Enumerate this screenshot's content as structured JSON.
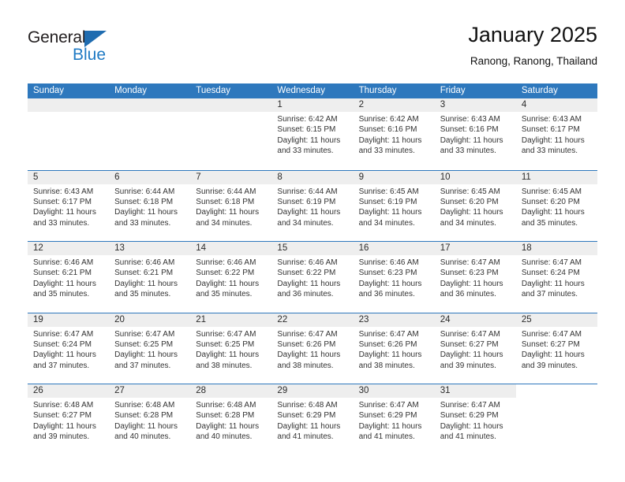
{
  "brand": {
    "name_top": "General",
    "name_bottom": "Blue",
    "triangle_icon": "triangle-icon",
    "accent_color": "#1f7ac4"
  },
  "header": {
    "title": "January 2025",
    "subtitle": "Ranong, Ranong, Thailand"
  },
  "colors": {
    "header_band": "#2e78bd",
    "daynum_band": "#eeeeee",
    "text": "#333333"
  },
  "weekdays": [
    "Sunday",
    "Monday",
    "Tuesday",
    "Wednesday",
    "Thursday",
    "Friday",
    "Saturday"
  ],
  "weeks": [
    {
      "band_cols": 7,
      "days": [
        {
          "num": "",
          "empty": true,
          "l1": "",
          "l2": "",
          "l3": "",
          "l4": ""
        },
        {
          "num": "",
          "empty": true,
          "l1": "",
          "l2": "",
          "l3": "",
          "l4": ""
        },
        {
          "num": "",
          "empty": true,
          "l1": "",
          "l2": "",
          "l3": "",
          "l4": ""
        },
        {
          "num": "1",
          "l1": "Sunrise: 6:42 AM",
          "l2": "Sunset: 6:15 PM",
          "l3": "Daylight: 11 hours",
          "l4": "and 33 minutes."
        },
        {
          "num": "2",
          "l1": "Sunrise: 6:42 AM",
          "l2": "Sunset: 6:16 PM",
          "l3": "Daylight: 11 hours",
          "l4": "and 33 minutes."
        },
        {
          "num": "3",
          "l1": "Sunrise: 6:43 AM",
          "l2": "Sunset: 6:16 PM",
          "l3": "Daylight: 11 hours",
          "l4": "and 33 minutes."
        },
        {
          "num": "4",
          "l1": "Sunrise: 6:43 AM",
          "l2": "Sunset: 6:17 PM",
          "l3": "Daylight: 11 hours",
          "l4": "and 33 minutes."
        }
      ]
    },
    {
      "band_cols": 7,
      "days": [
        {
          "num": "5",
          "l1": "Sunrise: 6:43 AM",
          "l2": "Sunset: 6:17 PM",
          "l3": "Daylight: 11 hours",
          "l4": "and 33 minutes."
        },
        {
          "num": "6",
          "l1": "Sunrise: 6:44 AM",
          "l2": "Sunset: 6:18 PM",
          "l3": "Daylight: 11 hours",
          "l4": "and 33 minutes."
        },
        {
          "num": "7",
          "l1": "Sunrise: 6:44 AM",
          "l2": "Sunset: 6:18 PM",
          "l3": "Daylight: 11 hours",
          "l4": "and 34 minutes."
        },
        {
          "num": "8",
          "l1": "Sunrise: 6:44 AM",
          "l2": "Sunset: 6:19 PM",
          "l3": "Daylight: 11 hours",
          "l4": "and 34 minutes."
        },
        {
          "num": "9",
          "l1": "Sunrise: 6:45 AM",
          "l2": "Sunset: 6:19 PM",
          "l3": "Daylight: 11 hours",
          "l4": "and 34 minutes."
        },
        {
          "num": "10",
          "l1": "Sunrise: 6:45 AM",
          "l2": "Sunset: 6:20 PM",
          "l3": "Daylight: 11 hours",
          "l4": "and 34 minutes."
        },
        {
          "num": "11",
          "l1": "Sunrise: 6:45 AM",
          "l2": "Sunset: 6:20 PM",
          "l3": "Daylight: 11 hours",
          "l4": "and 35 minutes."
        }
      ]
    },
    {
      "band_cols": 7,
      "days": [
        {
          "num": "12",
          "l1": "Sunrise: 6:46 AM",
          "l2": "Sunset: 6:21 PM",
          "l3": "Daylight: 11 hours",
          "l4": "and 35 minutes."
        },
        {
          "num": "13",
          "l1": "Sunrise: 6:46 AM",
          "l2": "Sunset: 6:21 PM",
          "l3": "Daylight: 11 hours",
          "l4": "and 35 minutes."
        },
        {
          "num": "14",
          "l1": "Sunrise: 6:46 AM",
          "l2": "Sunset: 6:22 PM",
          "l3": "Daylight: 11 hours",
          "l4": "and 35 minutes."
        },
        {
          "num": "15",
          "l1": "Sunrise: 6:46 AM",
          "l2": "Sunset: 6:22 PM",
          "l3": "Daylight: 11 hours",
          "l4": "and 36 minutes."
        },
        {
          "num": "16",
          "l1": "Sunrise: 6:46 AM",
          "l2": "Sunset: 6:23 PM",
          "l3": "Daylight: 11 hours",
          "l4": "and 36 minutes."
        },
        {
          "num": "17",
          "l1": "Sunrise: 6:47 AM",
          "l2": "Sunset: 6:23 PM",
          "l3": "Daylight: 11 hours",
          "l4": "and 36 minutes."
        },
        {
          "num": "18",
          "l1": "Sunrise: 6:47 AM",
          "l2": "Sunset: 6:24 PM",
          "l3": "Daylight: 11 hours",
          "l4": "and 37 minutes."
        }
      ]
    },
    {
      "band_cols": 7,
      "days": [
        {
          "num": "19",
          "l1": "Sunrise: 6:47 AM",
          "l2": "Sunset: 6:24 PM",
          "l3": "Daylight: 11 hours",
          "l4": "and 37 minutes."
        },
        {
          "num": "20",
          "l1": "Sunrise: 6:47 AM",
          "l2": "Sunset: 6:25 PM",
          "l3": "Daylight: 11 hours",
          "l4": "and 37 minutes."
        },
        {
          "num": "21",
          "l1": "Sunrise: 6:47 AM",
          "l2": "Sunset: 6:25 PM",
          "l3": "Daylight: 11 hours",
          "l4": "and 38 minutes."
        },
        {
          "num": "22",
          "l1": "Sunrise: 6:47 AM",
          "l2": "Sunset: 6:26 PM",
          "l3": "Daylight: 11 hours",
          "l4": "and 38 minutes."
        },
        {
          "num": "23",
          "l1": "Sunrise: 6:47 AM",
          "l2": "Sunset: 6:26 PM",
          "l3": "Daylight: 11 hours",
          "l4": "and 38 minutes."
        },
        {
          "num": "24",
          "l1": "Sunrise: 6:47 AM",
          "l2": "Sunset: 6:27 PM",
          "l3": "Daylight: 11 hours",
          "l4": "and 39 minutes."
        },
        {
          "num": "25",
          "l1": "Sunrise: 6:47 AM",
          "l2": "Sunset: 6:27 PM",
          "l3": "Daylight: 11 hours",
          "l4": "and 39 minutes."
        }
      ]
    },
    {
      "band_cols": 6,
      "days": [
        {
          "num": "26",
          "l1": "Sunrise: 6:48 AM",
          "l2": "Sunset: 6:27 PM",
          "l3": "Daylight: 11 hours",
          "l4": "and 39 minutes."
        },
        {
          "num": "27",
          "l1": "Sunrise: 6:48 AM",
          "l2": "Sunset: 6:28 PM",
          "l3": "Daylight: 11 hours",
          "l4": "and 40 minutes."
        },
        {
          "num": "28",
          "l1": "Sunrise: 6:48 AM",
          "l2": "Sunset: 6:28 PM",
          "l3": "Daylight: 11 hours",
          "l4": "and 40 minutes."
        },
        {
          "num": "29",
          "l1": "Sunrise: 6:48 AM",
          "l2": "Sunset: 6:29 PM",
          "l3": "Daylight: 11 hours",
          "l4": "and 41 minutes."
        },
        {
          "num": "30",
          "l1": "Sunrise: 6:47 AM",
          "l2": "Sunset: 6:29 PM",
          "l3": "Daylight: 11 hours",
          "l4": "and 41 minutes."
        },
        {
          "num": "31",
          "l1": "Sunrise: 6:47 AM",
          "l2": "Sunset: 6:29 PM",
          "l3": "Daylight: 11 hours",
          "l4": "and 41 minutes."
        },
        {
          "num": "",
          "empty": true,
          "l1": "",
          "l2": "",
          "l3": "",
          "l4": ""
        }
      ]
    }
  ]
}
